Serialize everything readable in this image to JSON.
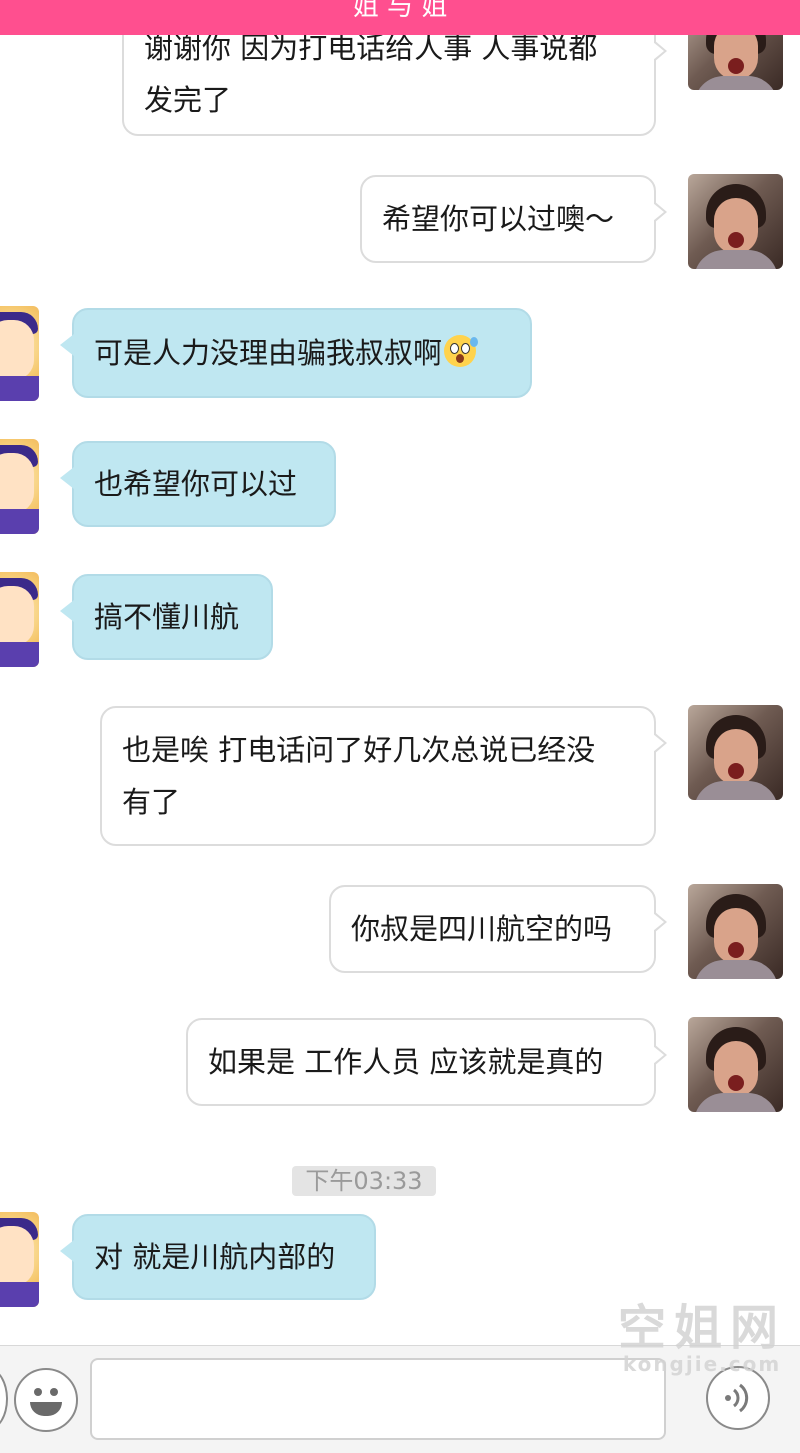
{
  "header": {
    "title": "姐 与 姐"
  },
  "messages": [
    {
      "side": "self",
      "lines": [
        "谢谢你 因为打电话给人事 人事说都",
        "发完了"
      ]
    },
    {
      "side": "self",
      "lines": [
        "希望你可以过噢～"
      ]
    },
    {
      "side": "other",
      "lines": [
        "可是人力没理由骗我叔叔啊"
      ],
      "emoji": "astonished-sweat-emoji"
    },
    {
      "side": "other",
      "lines": [
        "也希望你可以过"
      ]
    },
    {
      "side": "other",
      "lines": [
        "搞不懂川航"
      ]
    },
    {
      "side": "self",
      "lines": [
        "也是唉 打电话问了好几次总说已经没",
        "有了"
      ]
    },
    {
      "side": "self",
      "lines": [
        "你叔是四川航空的吗"
      ]
    },
    {
      "side": "self",
      "lines": [
        "如果是 工作人员 应该就是真的"
      ]
    },
    {
      "side": "other",
      "lines": [
        "对 就是川航内部的"
      ]
    }
  ],
  "timestamp": "下午03:33",
  "watermark": {
    "cn": "空姐网",
    "en": "kongjie.com"
  },
  "input_bar": {
    "placeholder": "",
    "value": ""
  },
  "icons": {
    "emoji_button": "smiley-icon",
    "voice_button": "voice-wave-icon"
  },
  "colors": {
    "header": "#ff4f8f",
    "incoming_bubble": "#bfe7f1",
    "outgoing_bubble": "#ffffff"
  }
}
